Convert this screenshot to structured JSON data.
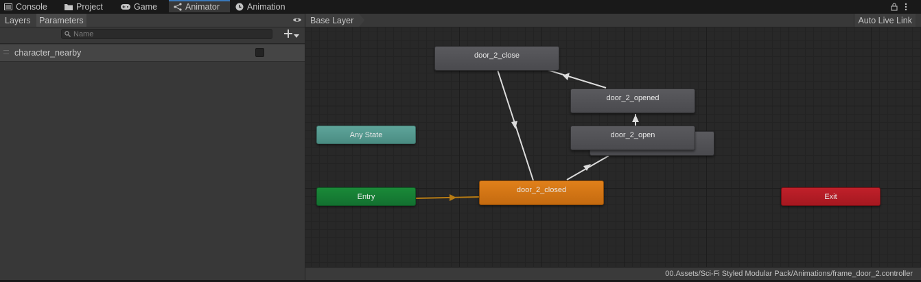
{
  "tabs": [
    {
      "label": "Console",
      "icon": "console-icon"
    },
    {
      "label": "Project",
      "icon": "folder-icon"
    },
    {
      "label": "Game",
      "icon": "gamepad-icon"
    },
    {
      "label": "Animator",
      "icon": "animator-icon",
      "active": true
    },
    {
      "label": "Animation",
      "icon": "clock-icon"
    }
  ],
  "window_icons": [
    "lock-icon",
    "more-vertical-icon"
  ],
  "left_panel": {
    "tabs": [
      {
        "label": "Layers"
      },
      {
        "label": "Parameters",
        "selected": true
      }
    ],
    "search_placeholder": "Name",
    "parameters": [
      {
        "name": "character_nearby",
        "type": "bool",
        "value": false
      }
    ]
  },
  "graph": {
    "breadcrumb": "Base Layer",
    "auto_live_link": "Auto Live Link",
    "path": "00.Assets/Sci-Fi Styled Modular Pack/Animations/frame_door_2.controller",
    "states": [
      {
        "id": "door_2_close",
        "label": "door_2_close",
        "kind": "normal"
      },
      {
        "id": "door_2_opened",
        "label": "door_2_opened",
        "kind": "normal"
      },
      {
        "id": "door_2_open",
        "label": "door_2_open",
        "kind": "normal"
      },
      {
        "id": "door_2_closed",
        "label": "door_2_closed",
        "kind": "default"
      },
      {
        "id": "any_state",
        "label": "Any State",
        "kind": "any"
      },
      {
        "id": "entry",
        "label": "Entry",
        "kind": "entry"
      },
      {
        "id": "exit",
        "label": "Exit",
        "kind": "exit"
      }
    ],
    "transitions": [
      {
        "from": "entry",
        "to": "door_2_closed"
      },
      {
        "from": "door_2_closed",
        "to": "door_2_open"
      },
      {
        "from": "door_2_open",
        "to": "door_2_opened"
      },
      {
        "from": "door_2_opened",
        "to": "door_2_close"
      },
      {
        "from": "door_2_close",
        "to": "door_2_closed"
      }
    ],
    "colors": {
      "default_state": "#e0801a",
      "any_state": "#5ea59a",
      "entry": "#1a8a38",
      "exit": "#c0202a",
      "normal_state": "#535357",
      "entry_transition": "#b87c14"
    }
  }
}
